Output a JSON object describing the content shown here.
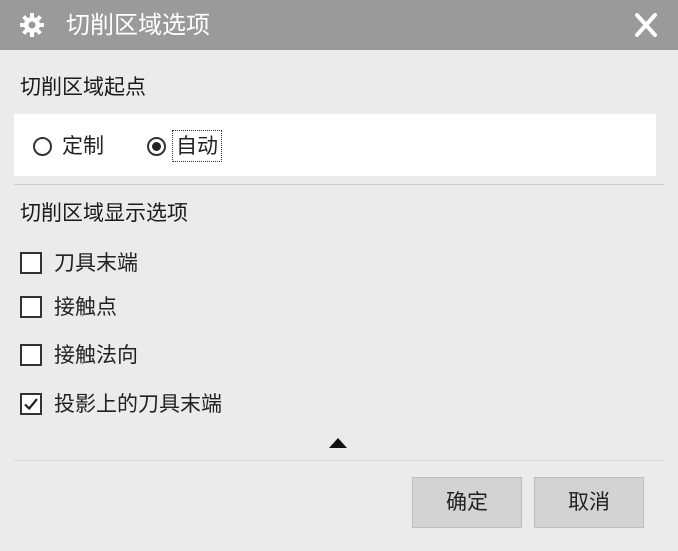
{
  "window": {
    "title": "切削区域选项"
  },
  "start_point": {
    "label": "切削区域起点",
    "options": [
      {
        "label": "定制",
        "selected": false
      },
      {
        "label": "自动",
        "selected": true
      }
    ]
  },
  "display_options": {
    "label": "切削区域显示选项",
    "items": [
      {
        "label": "刀具末端",
        "checked": false
      },
      {
        "label": "接触点",
        "checked": false
      },
      {
        "label": "接触法向",
        "checked": false
      },
      {
        "label": "投影上的刀具末端",
        "checked": true
      }
    ]
  },
  "footer": {
    "ok_label": "确定",
    "cancel_label": "取消"
  },
  "icons": {
    "title": "gear-icon",
    "close": "close-icon",
    "collapse": "triangle-up-icon"
  }
}
